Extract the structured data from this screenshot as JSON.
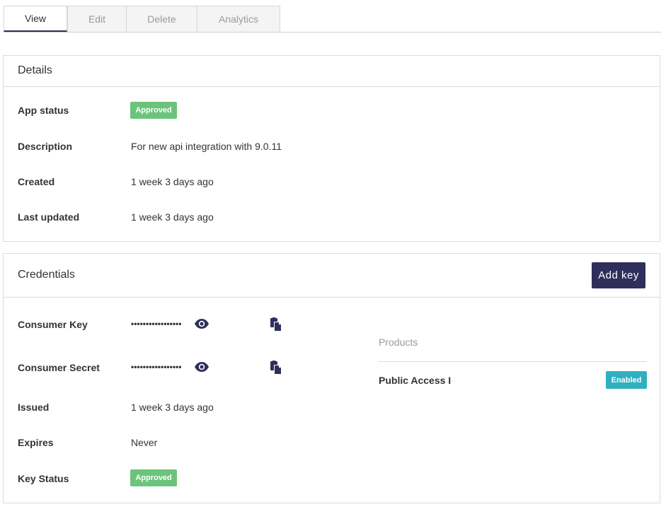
{
  "tabs": [
    {
      "label": "View",
      "active": true
    },
    {
      "label": "Edit",
      "active": false
    },
    {
      "label": "Delete",
      "active": false
    },
    {
      "label": "Analytics",
      "active": false
    }
  ],
  "details": {
    "title": "Details",
    "rows": [
      {
        "label": "App status",
        "badge": "Approved"
      },
      {
        "label": "Description",
        "value": "For new api integration with 9.0.11"
      },
      {
        "label": "Created",
        "value": "1 week 3 days ago"
      },
      {
        "label": "Last updated",
        "value": "1 week 3 days ago"
      }
    ]
  },
  "credentials": {
    "title": "Credentials",
    "add_key_label": "Add key",
    "consumer_key": {
      "label": "Consumer Key",
      "masked": "•••••••••••••••••"
    },
    "consumer_secret": {
      "label": "Consumer Secret",
      "masked": "•••••••••••••••••"
    },
    "issued": {
      "label": "Issued",
      "value": "1 week 3 days ago"
    },
    "expires": {
      "label": "Expires",
      "value": "Never"
    },
    "key_status": {
      "label": "Key Status",
      "badge": "Approved"
    },
    "products": {
      "title": "Products",
      "items": [
        {
          "name": "Public Access I",
          "status": "Enabled"
        }
      ]
    }
  },
  "colors": {
    "primary": "#2e2f5b",
    "approved": "#6cc47c",
    "enabled": "#2fb0c0",
    "border": "#dcdcdc"
  },
  "icons": {
    "reveal": "eye-icon",
    "copy": "copy-icon"
  }
}
